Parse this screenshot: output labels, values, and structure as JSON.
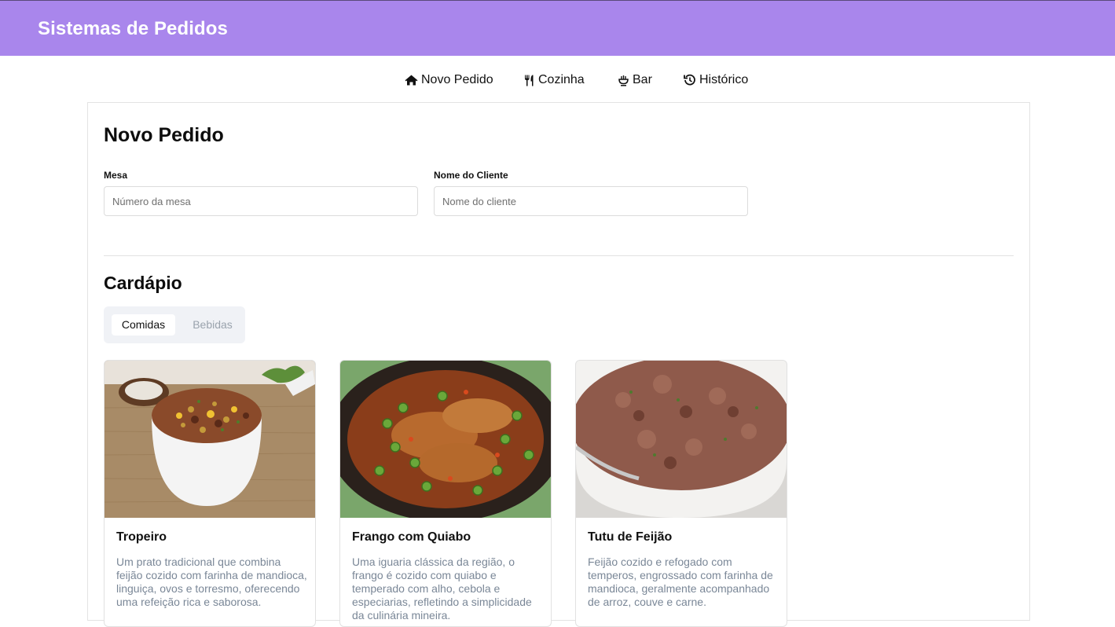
{
  "app": {
    "title": "Sistemas de Pedidos"
  },
  "nav": {
    "items": [
      {
        "label": "Novo Pedido",
        "icon": "home-icon"
      },
      {
        "label": "Cozinha",
        "icon": "utensils-icon"
      },
      {
        "label": "Bar",
        "icon": "cocktail-icon"
      },
      {
        "label": "Histórico",
        "icon": "history-icon"
      }
    ]
  },
  "form": {
    "title": "Novo Pedido",
    "mesa": {
      "label": "Mesa",
      "placeholder": "Número da mesa",
      "value": ""
    },
    "cliente": {
      "label": "Nome do Cliente",
      "placeholder": "Nome do cliente",
      "value": ""
    }
  },
  "menu": {
    "title": "Cardápio",
    "tabs": [
      {
        "label": "Comidas",
        "active": true
      },
      {
        "label": "Bebidas",
        "active": false
      }
    ],
    "items": [
      {
        "name": "Tropeiro",
        "description": "Um prato tradicional que combina feijão cozido com farinha de mandioca, linguiça, ovos e torresmo, oferecendo uma refeição rica e saborosa."
      },
      {
        "name": "Frango com Quiabo",
        "description": "Uma iguaria clássica da região, o frango é cozido com quiabo e temperado com alho, cebola e especiarias, refletindo a simplicidade da culinária mineira."
      },
      {
        "name": "Tutu de Feijão",
        "description": "Feijão cozido e refogado com temperos, engrossado com farinha de mandioca, geralmente acompanhado de arroz, couve e carne."
      }
    ]
  },
  "colors": {
    "header": "#a986ec",
    "muted_text": "#7a8797",
    "tab_bg": "#f0f2f6"
  }
}
